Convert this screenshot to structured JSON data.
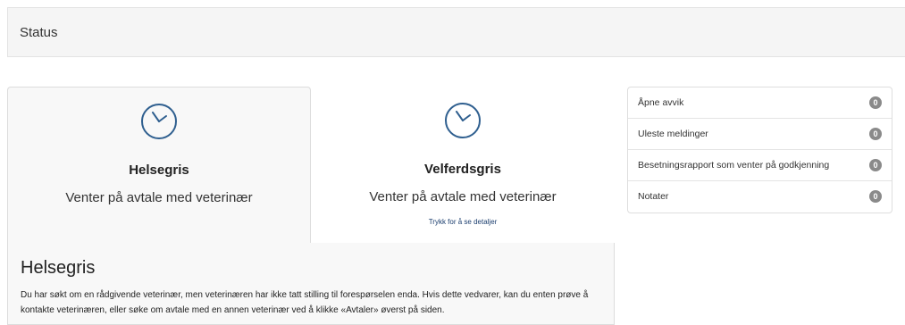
{
  "status_bar": {
    "title": "Status"
  },
  "tabs": [
    {
      "name": "Helsegris",
      "status": "Venter på avtale med veterinær",
      "link": ""
    },
    {
      "name": "Velferdsgris",
      "status": "Venter på avtale med veterinær",
      "link": "Trykk for å se detaljer"
    }
  ],
  "detail": {
    "title": "Helsegris",
    "text": "Du har søkt om en rådgivende veterinær, men veterinæren har ikke tatt stilling til forespørselen enda. Hvis dette vedvarer, kan du enten prøve å kontakte veterinæren, eller søke om avtale med en annen veterinær ved å klikke «Avtaler» øverst på siden."
  },
  "list": {
    "items": [
      {
        "label": "Åpne avvik",
        "count": "0"
      },
      {
        "label": "Uleste meldinger",
        "count": "0"
      },
      {
        "label": "Besetningsrapport som venter på godkjenning",
        "count": "0"
      },
      {
        "label": "Notater",
        "count": "0"
      }
    ]
  },
  "icons": {
    "clock": "clock-icon"
  },
  "colors": {
    "clock": "#2f5f8f",
    "badge": "#8a8a8a",
    "link": "#1a3d6e"
  }
}
